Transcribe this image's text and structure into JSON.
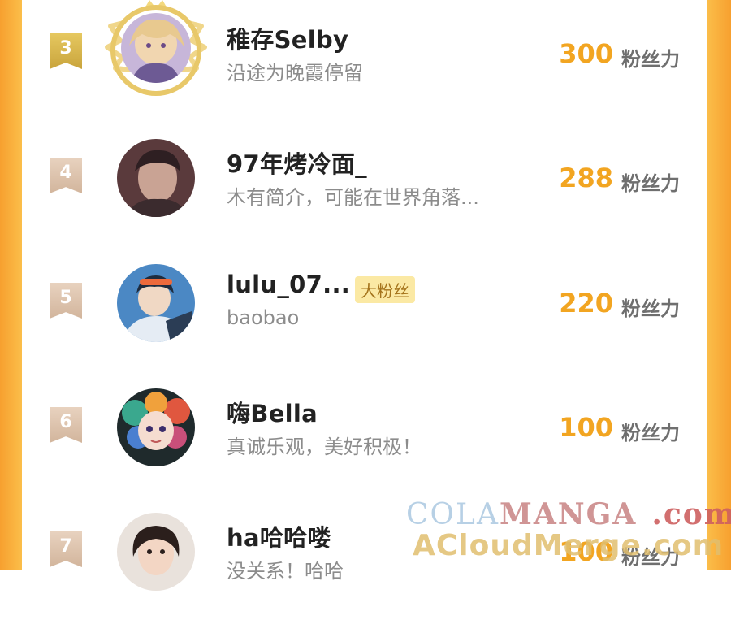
{
  "colors": {
    "accent": "#f2a521",
    "frame": "#f7a02f",
    "rank_gold": "#d4b04a",
    "rank_beige": "#dcc1a8"
  },
  "rows": [
    {
      "rank": "3",
      "name": "稚存Selby",
      "subtitle": "沿途为晚霞停留",
      "score": "300",
      "unit": "粉丝力",
      "avatar_icon": "anime-avatar",
      "crowned": true
    },
    {
      "rank": "4",
      "name": "97年烤冷面_",
      "subtitle": "木有简介，可能在世界角落...",
      "score": "288",
      "unit": "粉丝力",
      "avatar_icon": "photo-avatar"
    },
    {
      "rank": "5",
      "name": "lulu_07...",
      "badge": "大粉丝",
      "subtitle": "baobao",
      "score": "220",
      "unit": "粉丝力",
      "avatar_icon": "anime-avatar"
    },
    {
      "rank": "6",
      "name": "嗨Bella",
      "subtitle": "真诚乐观，美好积极！",
      "score": "100",
      "unit": "粉丝力",
      "avatar_icon": "cartoon-avatar"
    },
    {
      "rank": "7",
      "name": "ha哈哈喽",
      "subtitle": "没关系！哈哈",
      "score": "100",
      "unit": "粉丝力",
      "avatar_icon": "photo-avatar"
    }
  ],
  "watermark": {
    "line1_a": "COLA",
    "line1_b": "MANGA",
    "line1_c": ".com",
    "line2": "ACloudMerge.com"
  }
}
